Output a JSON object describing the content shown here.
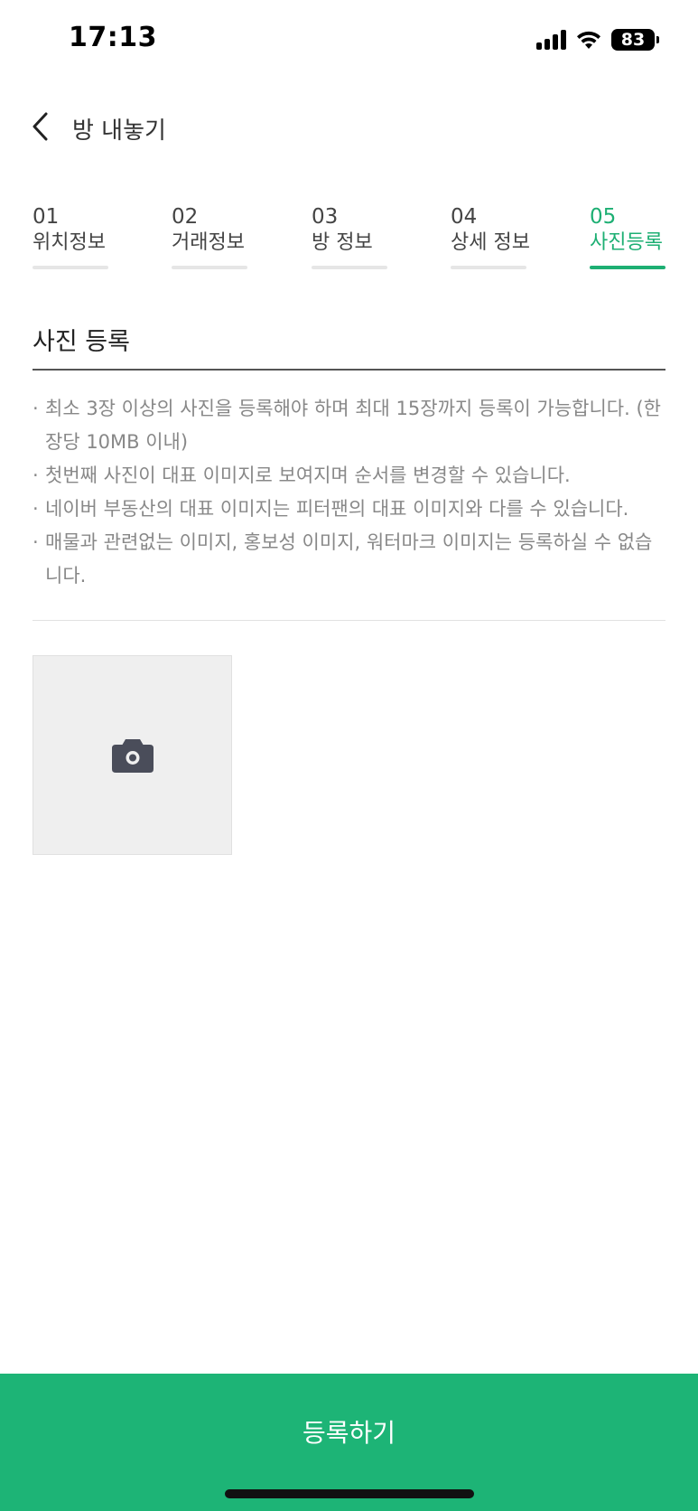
{
  "status_bar": {
    "time": "17:13",
    "battery": "83",
    "icons": [
      "signal-icon",
      "wifi-icon",
      "battery-icon"
    ]
  },
  "header": {
    "title": "방 내놓기",
    "back_icon": "chevron-left-icon"
  },
  "steps": [
    {
      "num": "01",
      "label": "위치정보",
      "active": false
    },
    {
      "num": "02",
      "label": "거래정보",
      "active": false
    },
    {
      "num": "03",
      "label": "방 정보",
      "active": false
    },
    {
      "num": "04",
      "label": "상세 정보",
      "active": false
    },
    {
      "num": "05",
      "label": "사진등록",
      "active": true
    }
  ],
  "section": {
    "title": "사진 등록"
  },
  "notes": [
    "최소 3장 이상의 사진을 등록해야 하며 최대 15장까지 등록이 가능합니다. (한 장당 10MB 이내)",
    "첫번째 사진이 대표 이미지로 보여지며 순서를 변경할 수 있습니다.",
    "네이버 부동산의 대표 이미지는 피터팬의 대표 이미지와 다를 수 있습니다.",
    "매물과 관련없는 이미지, 홍보성 이미지, 워터마크 이미지는 등록하실 수 없습니다."
  ],
  "photo_slot": {
    "icon": "camera-icon"
  },
  "footer": {
    "register_label": "등록하기"
  },
  "colors": {
    "accent": "#1daf73",
    "button": "#1db476",
    "muted_text": "#888888"
  }
}
